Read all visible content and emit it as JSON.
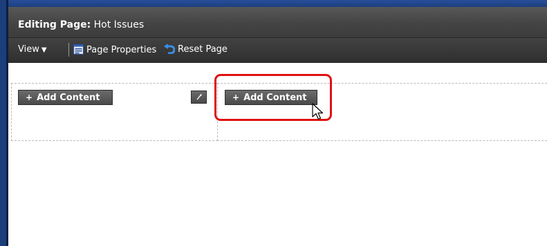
{
  "header": {
    "title_label": "Editing Page:",
    "page_name": "Hot Issues"
  },
  "toolbar": {
    "view_label": "View",
    "page_properties_label": "Page Properties",
    "reset_page_label": "Reset Page"
  },
  "zones": {
    "left_add_label": "Add Content",
    "right_add_label": "Add Content"
  },
  "icons": {
    "view": "chevron-down-icon",
    "page_properties": "page-properties-icon",
    "reset_page": "undo-icon",
    "add": "plus-icon",
    "edit": "pencil-icon",
    "cursor": "mouse-pointer-icon"
  },
  "colors": {
    "header_bg": "#444444",
    "window_border": "#1c3e7a",
    "highlight": "#e01010"
  }
}
